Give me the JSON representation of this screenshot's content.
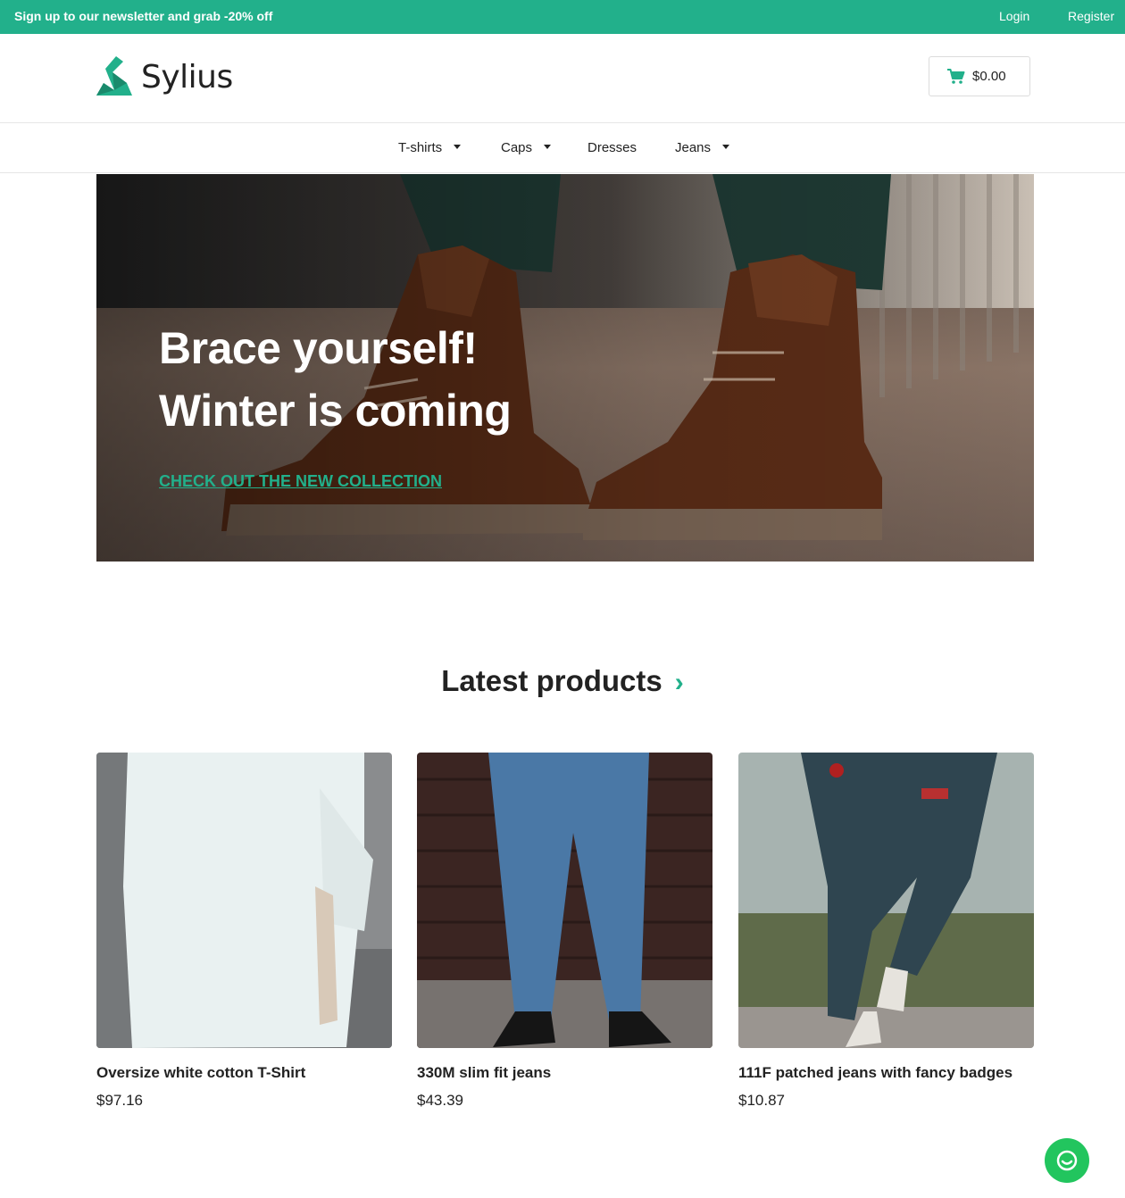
{
  "topbar": {
    "promo": "Sign up to our newsletter and grab -20% off",
    "login": "Login",
    "register": "Register"
  },
  "header": {
    "logo_text": "Sylius",
    "cart_total": "$0.00"
  },
  "nav": {
    "items": [
      {
        "label": "T-shirts",
        "has_dropdown": true
      },
      {
        "label": "Caps",
        "has_dropdown": true
      },
      {
        "label": "Dresses",
        "has_dropdown": false
      },
      {
        "label": "Jeans",
        "has_dropdown": true
      }
    ]
  },
  "hero": {
    "title_line1": "Brace yourself!",
    "title_line2": "Winter is coming",
    "cta": "CHECK OUT THE NEW COLLECTION"
  },
  "latest": {
    "title": "Latest products",
    "products": [
      {
        "name": "Oversize white cotton T-Shirt",
        "price": "$97.16"
      },
      {
        "name": "330M slim fit jeans",
        "price": "$43.39"
      },
      {
        "name": "111F patched jeans with fancy badges",
        "price": "$10.87"
      }
    ]
  },
  "colors": {
    "brand": "#22b08b",
    "chat": "#22c55e",
    "text": "#222222"
  },
  "icons": {
    "cart": "cart-icon",
    "chat": "chat-icon",
    "chevron": "chevron-right-icon",
    "caret": "caret-down-icon"
  }
}
